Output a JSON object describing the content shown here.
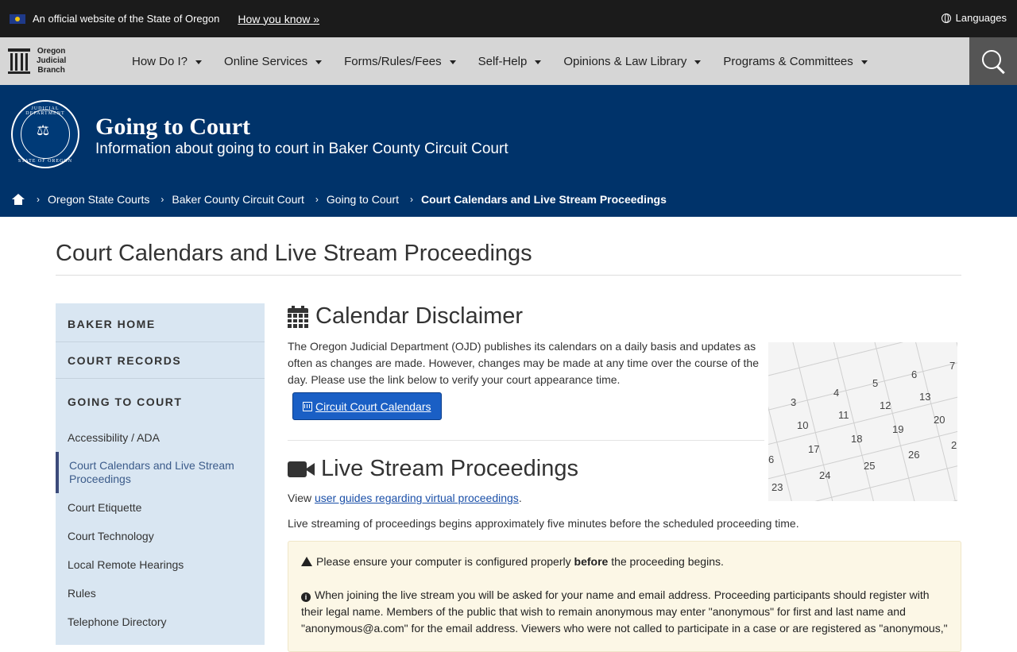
{
  "banner": {
    "official_text": "An official website of the State of Oregon",
    "how_link": "How you know »",
    "languages": "Languages"
  },
  "logo": {
    "line1": "Oregon",
    "line2": "Judicial",
    "line3": "Branch"
  },
  "nav": {
    "items": [
      {
        "label": "How Do I?"
      },
      {
        "label": "Online Services"
      },
      {
        "label": "Forms/Rules/Fees"
      },
      {
        "label": "Self-Help"
      },
      {
        "label": "Opinions & Law Library"
      },
      {
        "label": "Programs & Committees"
      }
    ]
  },
  "hero": {
    "seal_text": "JUDICIAL DEPARTMENT",
    "seal_bottom": "STATE OF OREGON",
    "title": "Going to Court",
    "subtitle": "Information about going to court in Baker County Circuit Court"
  },
  "breadcrumb": {
    "items": [
      "Oregon State Courts",
      "Baker County Circuit Court",
      "Going to Court"
    ],
    "current": "Court Calendars and Live Stream Proceedings"
  },
  "page": {
    "title": "Court Calendars and Live Stream Proceedings"
  },
  "sidebar": {
    "head1": "BAKER HOME",
    "head2": "COURT RECORDS",
    "head3": "GOING TO COURT",
    "links": [
      "Accessibility / ADA",
      "Court Calendars and Live Stream Proceedings",
      "Court Etiquette",
      "Court Technology",
      "Local Remote Hearings",
      "Rules",
      "Telephone Directory"
    ]
  },
  "calendar": {
    "heading": "Calendar Disclaimer",
    "body": "The Oregon Judicial Department (OJD) publishes its calendars on a daily basis and updates as often as changes are made. However, changes may be made at any time over the course of the day. Please use the link below to verify your court appearance time.",
    "button": "Circuit Court Calendars",
    "numbers": [
      "3",
      "4",
      "5",
      "6",
      "7",
      "10",
      "11",
      "12",
      "13",
      "17",
      "18",
      "19",
      "20",
      "23",
      "24",
      "25",
      "26",
      "2",
      "6"
    ]
  },
  "live": {
    "heading": "Live Stream Proceedings",
    "view_prefix": "View ",
    "view_link": "user guides regarding virtual proceedings",
    "view_suffix": ".",
    "stream_text": "Live streaming of proceedings begins approximately five minutes before the scheduled proceeding time.",
    "alert_warn_pre": "Please ensure your computer is configured properly ",
    "alert_warn_bold": "before",
    "alert_warn_post": " the proceeding begins.",
    "alert_info": "When joining the live stream you will be asked for your name and email address. Proceeding participants should register with their legal name. Members of the public that wish to remain anonymous may enter \"anonymous\" for first and last name and \"anonymous@a.com\" for the email address. Viewers who were not called to participate in a case or are registered as \"anonymous,\""
  }
}
